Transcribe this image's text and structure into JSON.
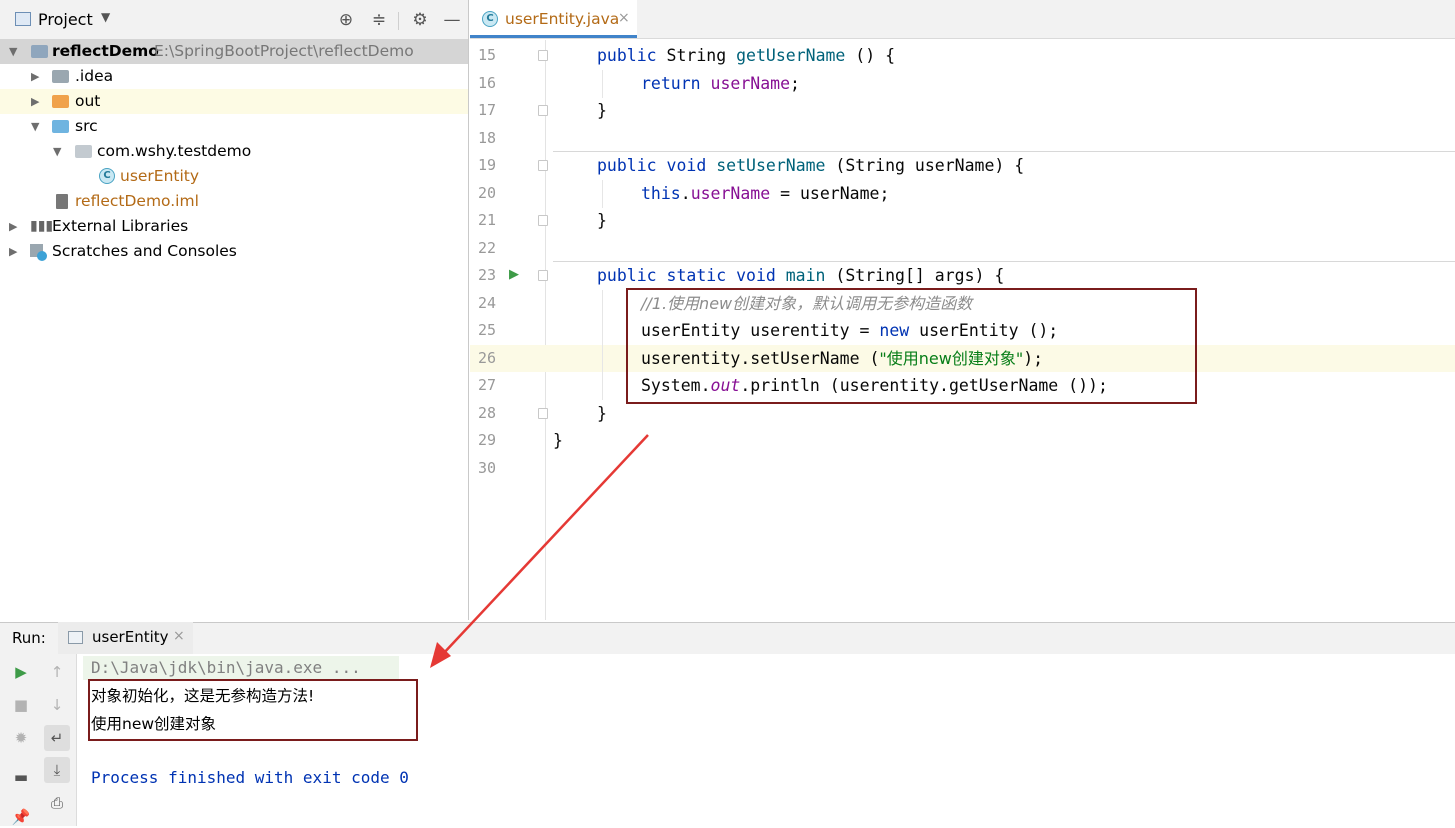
{
  "project_panel": {
    "title": "Project",
    "tree": [
      {
        "label": "reflectDemo",
        "path": "E:\\SpringBootProject\\reflectDemo"
      },
      {
        "label": ".idea"
      },
      {
        "label": "out"
      },
      {
        "label": "src"
      },
      {
        "label": "com.wshy.testdemo"
      },
      {
        "label": "userEntity"
      },
      {
        "label": "reflectDemo.iml"
      },
      {
        "label": "External Libraries"
      },
      {
        "label": "Scratches and Consoles"
      }
    ]
  },
  "editor": {
    "tab_label": "userEntity.java",
    "line_numbers": [
      "15",
      "16",
      "17",
      "18",
      "19",
      "20",
      "21",
      "22",
      "23",
      "24",
      "25",
      "26",
      "27",
      "28",
      "29",
      "30"
    ],
    "code": {
      "l15a": "public ",
      "l15b": "String ",
      "l15c": "getUserName",
      "l15d": " () {",
      "l16a": "return ",
      "l16b": "userName",
      "l16c": ";",
      "l17": "}",
      "l19a": "public void ",
      "l19b": "setUserName",
      "l19c": " (String userName) {",
      "l20a": "this",
      "l20b": ".",
      "l20c": "userName",
      "l20d": " = userName;",
      "l21": "}",
      "l23a": "public static void ",
      "l23b": "main",
      "l23c": " (String[] args) {",
      "l24": "//1.使用new创建对象，默认调用无参构造函数",
      "l25a": "userEntity userentity = ",
      "l25b": "new",
      "l25c": " userEntity ();",
      "l26a": "userentity.setUserName (",
      "l26b": "\"使用new创建对象\"",
      "l26c": ");",
      "l27a": "System.",
      "l27b": "out",
      "l27c": ".println (userentity.getUserName ());",
      "l28": "}",
      "l29": "}"
    }
  },
  "run_panel": {
    "label": "Run:",
    "tab_label": "userEntity",
    "console": {
      "cmd": "D:\\Java\\jdk\\bin\\java.exe ...",
      "out1": "对象初始化，这是无参构造方法!",
      "out2": "使用new创建对象",
      "exit": "Process finished with exit code 0"
    }
  },
  "colors": {
    "keyword": "#0033b3",
    "field": "#871094",
    "string": "#067d17",
    "comment": "#8c8c8c",
    "annotation_box": "#7a1c1c",
    "arrow": "#e53935"
  }
}
